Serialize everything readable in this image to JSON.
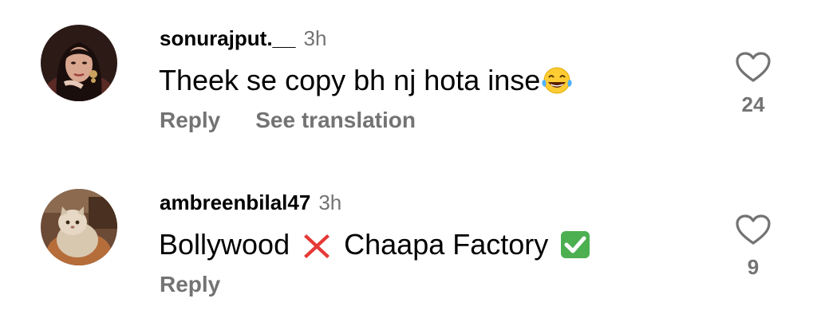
{
  "comments": [
    {
      "username": "sonurajput.__",
      "time": "3h",
      "text_main": "Theek se copy bh nj hota inse",
      "emoji": "laughing-tears-emoji",
      "actions": {
        "reply": "Reply",
        "translate": "See translation"
      },
      "likes": "24",
      "avatar": "woman-portrait-avatar"
    },
    {
      "username": "ambreenbilal47",
      "time": "3h",
      "text_part1": "Bollywood",
      "text_part2": "Chaapa Factory",
      "emoji_cross": "red-x-emoji",
      "emoji_check": "green-check-emoji",
      "actions": {
        "reply": "Reply"
      },
      "likes": "9",
      "avatar": "persian-cat-avatar"
    }
  ],
  "colors": {
    "primary_text": "#000000",
    "secondary_text": "#737373",
    "red_x": "#e53935",
    "green_check": "#4caf50"
  }
}
